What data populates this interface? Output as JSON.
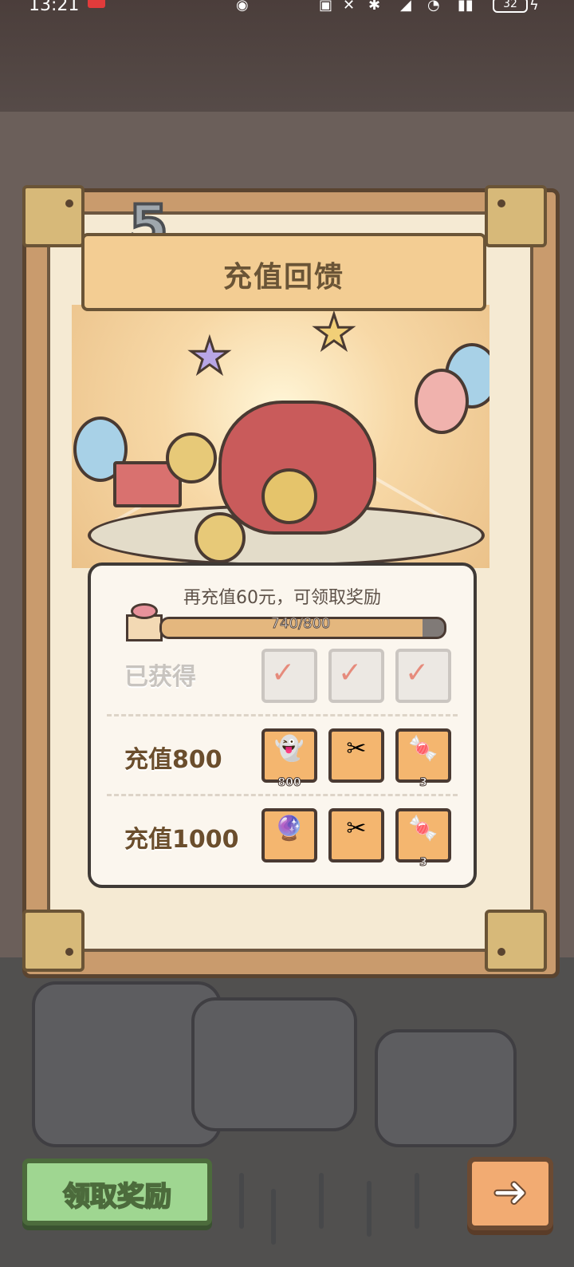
{
  "status_bar": {
    "time": "13:21",
    "battery": "32"
  },
  "event": {
    "badge_number": "5",
    "title": "充值回馈"
  },
  "reward_card": {
    "prompt": "再充值60元，可领取奖励",
    "progress": {
      "current": 740,
      "total": 800,
      "text": "740/800",
      "fraction": 0.925
    },
    "rows": [
      {
        "label": "已获得",
        "state": "claimed",
        "items": [
          {
            "icon": "ghost-token-icon",
            "qty": ""
          },
          {
            "icon": "scissors-icon",
            "qty": ""
          },
          {
            "icon": "candy-pack-icon",
            "qty": ""
          }
        ]
      },
      {
        "label": "充值800",
        "state": "available",
        "items": [
          {
            "icon": "ghost-token-icon",
            "qty": "800"
          },
          {
            "icon": "scissors-icon",
            "qty": ""
          },
          {
            "icon": "candy-pack-icon",
            "qty": "3"
          }
        ]
      },
      {
        "label": "充值1000",
        "state": "available",
        "items": [
          {
            "icon": "crystal-orb-icon",
            "qty": ""
          },
          {
            "icon": "scissors-icon",
            "qty": ""
          },
          {
            "icon": "candy-pack-icon",
            "qty": "3"
          }
        ]
      }
    ]
  },
  "actions": {
    "claim_label": "领取奖励",
    "next_icon": "arrow-right-icon"
  }
}
